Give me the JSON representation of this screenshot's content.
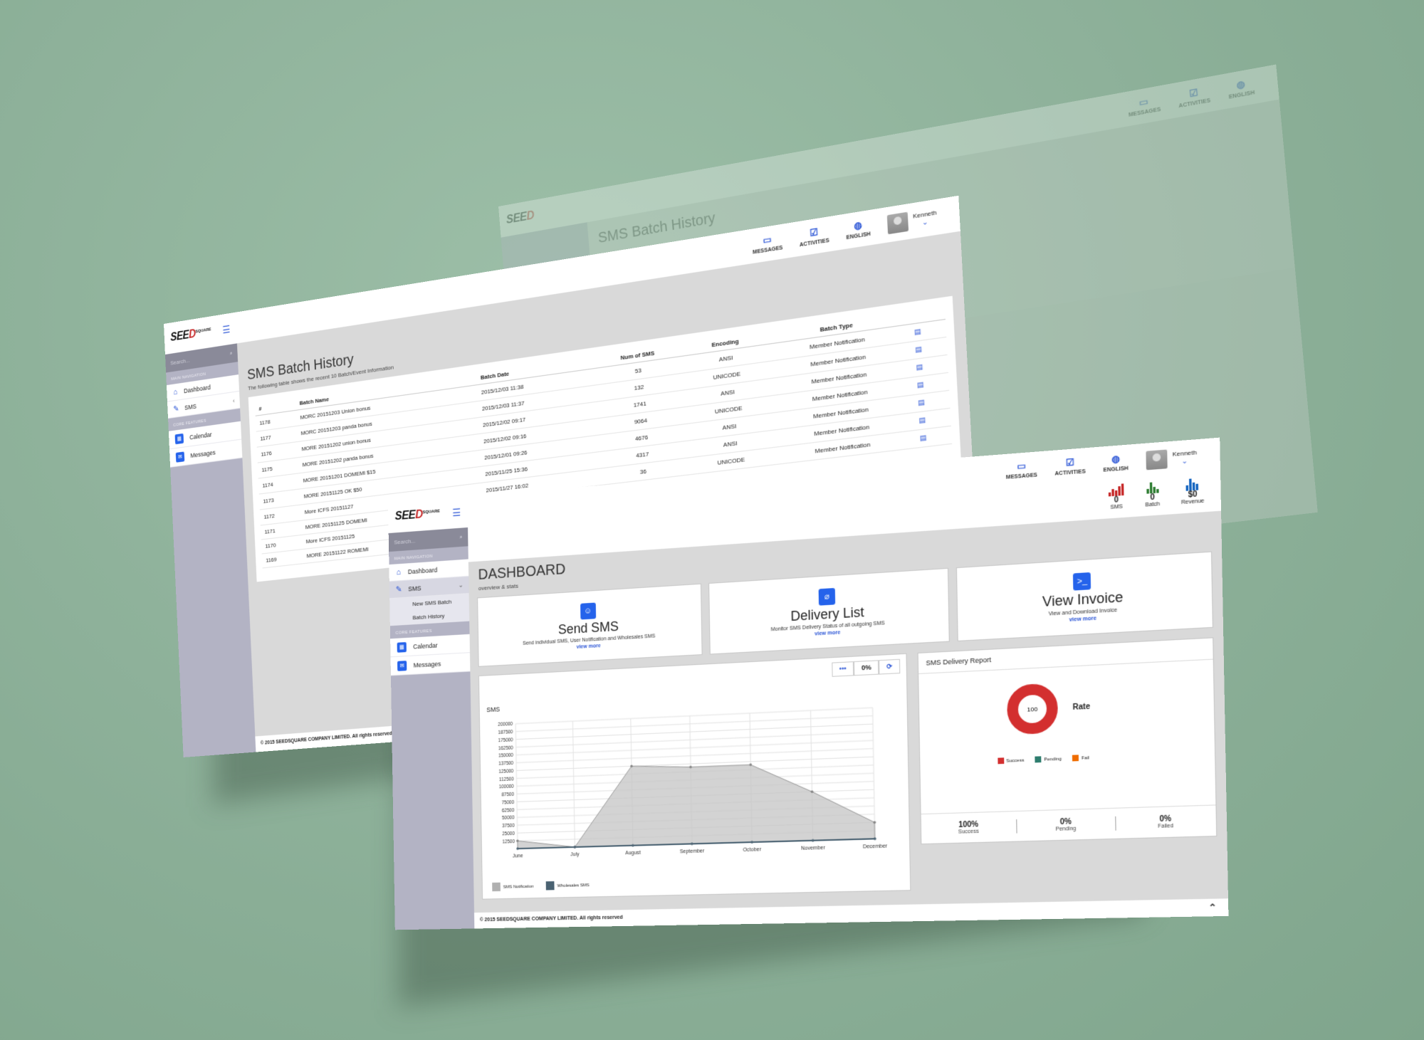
{
  "brand": {
    "logo_text": "SEE",
    "logo_accent": "D",
    "logo_super": "SQUARE"
  },
  "topbar": {
    "messages": "MESSAGES",
    "activities": "ACTIVITIES",
    "language": "ENGLISH",
    "user": "Kenneth"
  },
  "sidebar": {
    "search_placeholder": "Search...",
    "main_nav_title": "MAIN NAVIGATION",
    "dashboard": "Dashboard",
    "sms": "SMS",
    "sms_sub": [
      "New SMS Batch",
      "Batch History"
    ],
    "features_title": "CORE FEATURES",
    "calendar": "Calendar",
    "messages": "Messages"
  },
  "batch_page": {
    "title": "SMS Batch History",
    "subtitle": "The following table shows the recent 10 Batch/Event Information",
    "columns": [
      "#",
      "Batch Name",
      "Batch Date",
      "Num of SMS",
      "Encoding",
      "Batch Type"
    ],
    "rows": [
      [
        "1178",
        "MORC 20151203 Union bonus",
        "2015/12/03 11:38",
        "53",
        "ANSI",
        "Member Notification"
      ],
      [
        "1177",
        "MORC 20151203 panda bonus",
        "2015/12/03 11:37",
        "132",
        "UNICODE",
        "Member Notification"
      ],
      [
        "1176",
        "MORE 20151202 union bonus",
        "2015/12/02 09:17",
        "1741",
        "ANSI",
        "Member Notification"
      ],
      [
        "1175",
        "MORE 20151202 panda bonus",
        "2015/12/02 09:16",
        "9064",
        "UNICODE",
        "Member Notification"
      ],
      [
        "1174",
        "MORE 20151201 DOMEMI $15",
        "2015/12/01 09:26",
        "4676",
        "ANSI",
        "Member Notification"
      ],
      [
        "1173",
        "MORE 20151125 OK $50",
        "2015/11/25 15:36",
        "4317",
        "ANSI",
        "Member Notification"
      ],
      [
        "1172",
        "More ICFS 20151127",
        "2015/11/27 16:02",
        "36",
        "UNICODE",
        "Member Notification"
      ],
      [
        "1171",
        "MORE 20151125 DOMEMI",
        "",
        "",
        "",
        ""
      ],
      [
        "1170",
        "More ICFS 20151125",
        "",
        "",
        "",
        ""
      ],
      [
        "1169",
        "MORE 20151122 ROMEMI",
        "",
        "",
        "",
        ""
      ]
    ]
  },
  "footer": {
    "text": "© 2015 SEEDSQUARE COMPANY LIMITED. All rights reserved"
  },
  "dashboard": {
    "title": "DASHBOARD",
    "subtitle": "overview & stats",
    "stats": [
      {
        "value": "0",
        "label": "SMS",
        "color": "#c62828"
      },
      {
        "value": "0",
        "label": "Batch",
        "color": "#2e7d32"
      },
      {
        "value": "$0",
        "label": "Revenue",
        "color": "#1565c0"
      }
    ],
    "cards": [
      {
        "title": "Send SMS",
        "desc": "Send individual SMS, User Notification and Wholesales SMS",
        "link": "view more",
        "icon": "smile-icon"
      },
      {
        "title": "Delivery List",
        "desc": "Monitor SMS Delivery Status of all outgoing SMS",
        "link": "view more",
        "icon": "clip-icon"
      },
      {
        "title": "View Invoice",
        "desc": "View and Download Invoice",
        "link": "view more",
        "icon": "terminal-icon"
      }
    ],
    "chart_tools": {
      "more": "•••",
      "percent": "0%",
      "refresh": "⟳"
    },
    "chart_title": "SMS",
    "legend": [
      "SMS Notification",
      "Wholesales SMS"
    ],
    "report": {
      "title": "SMS Delivery Report",
      "donut_value": "100",
      "rate_label": "Rate",
      "legend": [
        "Success",
        "Pending",
        "Fail"
      ],
      "legend_colors": [
        "#d32f2f",
        "#2e7d6e",
        "#ef6c00"
      ],
      "stats": [
        {
          "value": "100%",
          "label": "Success"
        },
        {
          "value": "0%",
          "label": "Pending"
        },
        {
          "value": "0%",
          "label": "Failed"
        }
      ]
    }
  },
  "chart_data": {
    "type": "area",
    "title": "SMS",
    "categories": [
      "June",
      "July",
      "August",
      "September",
      "October",
      "November",
      "December"
    ],
    "y_ticks": [
      "200000",
      "187500",
      "175000",
      "162500",
      "150000",
      "137500",
      "125000",
      "112500",
      "100000",
      "87500",
      "75000",
      "62500",
      "50000",
      "37500",
      "25000",
      "12500"
    ],
    "ylim": [
      0,
      200000
    ],
    "series": [
      {
        "name": "SMS Notification",
        "values": [
          12500,
          0,
          125000,
          120000,
          120000,
          75000,
          25000
        ],
        "color": "#c4c4c4"
      },
      {
        "name": "Wholesales SMS",
        "values": [
          0,
          0,
          0,
          0,
          0,
          0,
          0
        ],
        "color": "#4a6272"
      }
    ]
  }
}
